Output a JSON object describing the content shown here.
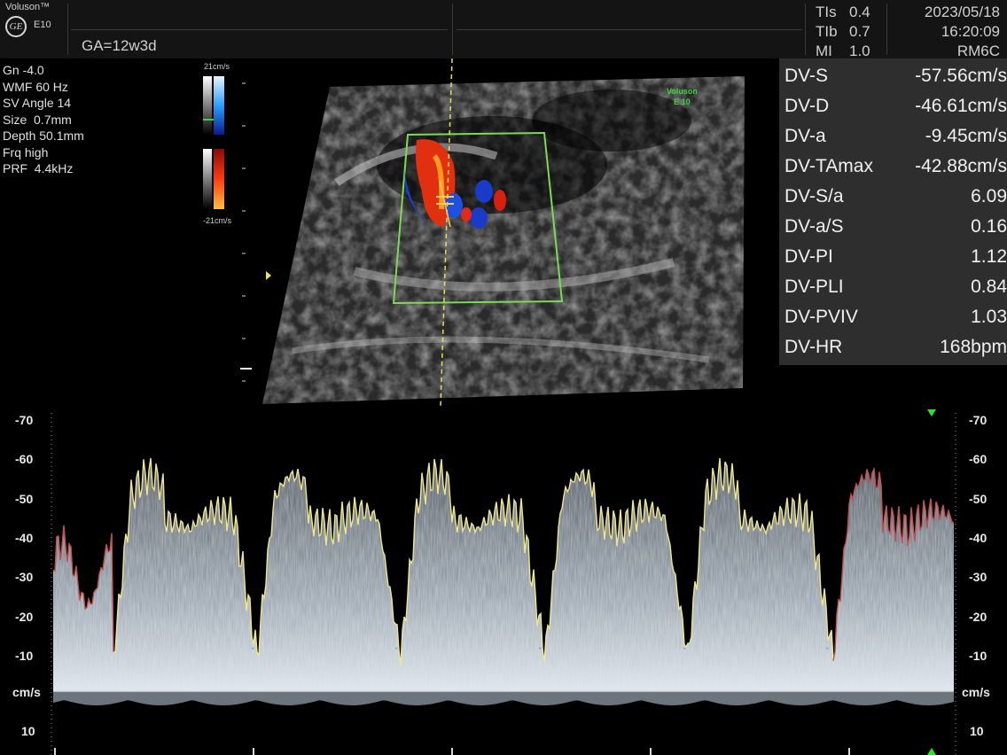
{
  "header": {
    "brand": "Voluson™",
    "logo_text": "GE",
    "model": "E10",
    "ga": "GA=12w3d",
    "safety": [
      {
        "label": "TIs",
        "value": "0.4"
      },
      {
        "label": "TIb",
        "value": "0.7"
      },
      {
        "label": "MI",
        "value": "1.0"
      }
    ],
    "date": "2023/05/18",
    "time": "16:20:09",
    "probe": "RM6C"
  },
  "params": "Gn -4.0\nWMF 60 Hz\nSV Angle 14\nSize  0.7mm\nDepth 50.1mm\nFrq high\nPRF  4.4kHz",
  "color_bar": {
    "top": "21cm/s",
    "bottom": "-21cm/s"
  },
  "watermark": {
    "line1": "Voluson",
    "line2": "E 10"
  },
  "measurements": [
    {
      "label": "DV-S",
      "value": "-57.56cm/s"
    },
    {
      "label": "DV-D",
      "value": "-46.61cm/s"
    },
    {
      "label": "DV-a",
      "value": "-9.45cm/s"
    },
    {
      "label": "DV-TAmax",
      "value": "-42.88cm/s"
    },
    {
      "label": "DV-S/a",
      "value": "6.09"
    },
    {
      "label": "DV-a/S",
      "value": "0.16"
    },
    {
      "label": "DV-PI",
      "value": "1.12"
    },
    {
      "label": "DV-PLI",
      "value": "0.84"
    },
    {
      "label": "DV-PVIV",
      "value": "1.03"
    },
    {
      "label": "DV-HR",
      "value": "168bpm"
    }
  ],
  "spectrum_axis": {
    "ticks": [
      "-70",
      "-60",
      "-50",
      "-40",
      "-30",
      "-20",
      "-10"
    ],
    "unit": "cm/s",
    "below": "10"
  },
  "colors": {
    "trace": "#f0e68c",
    "roi": "#7ed957",
    "sample_line": "#e8e060",
    "panel": "#2e2e2e"
  }
}
